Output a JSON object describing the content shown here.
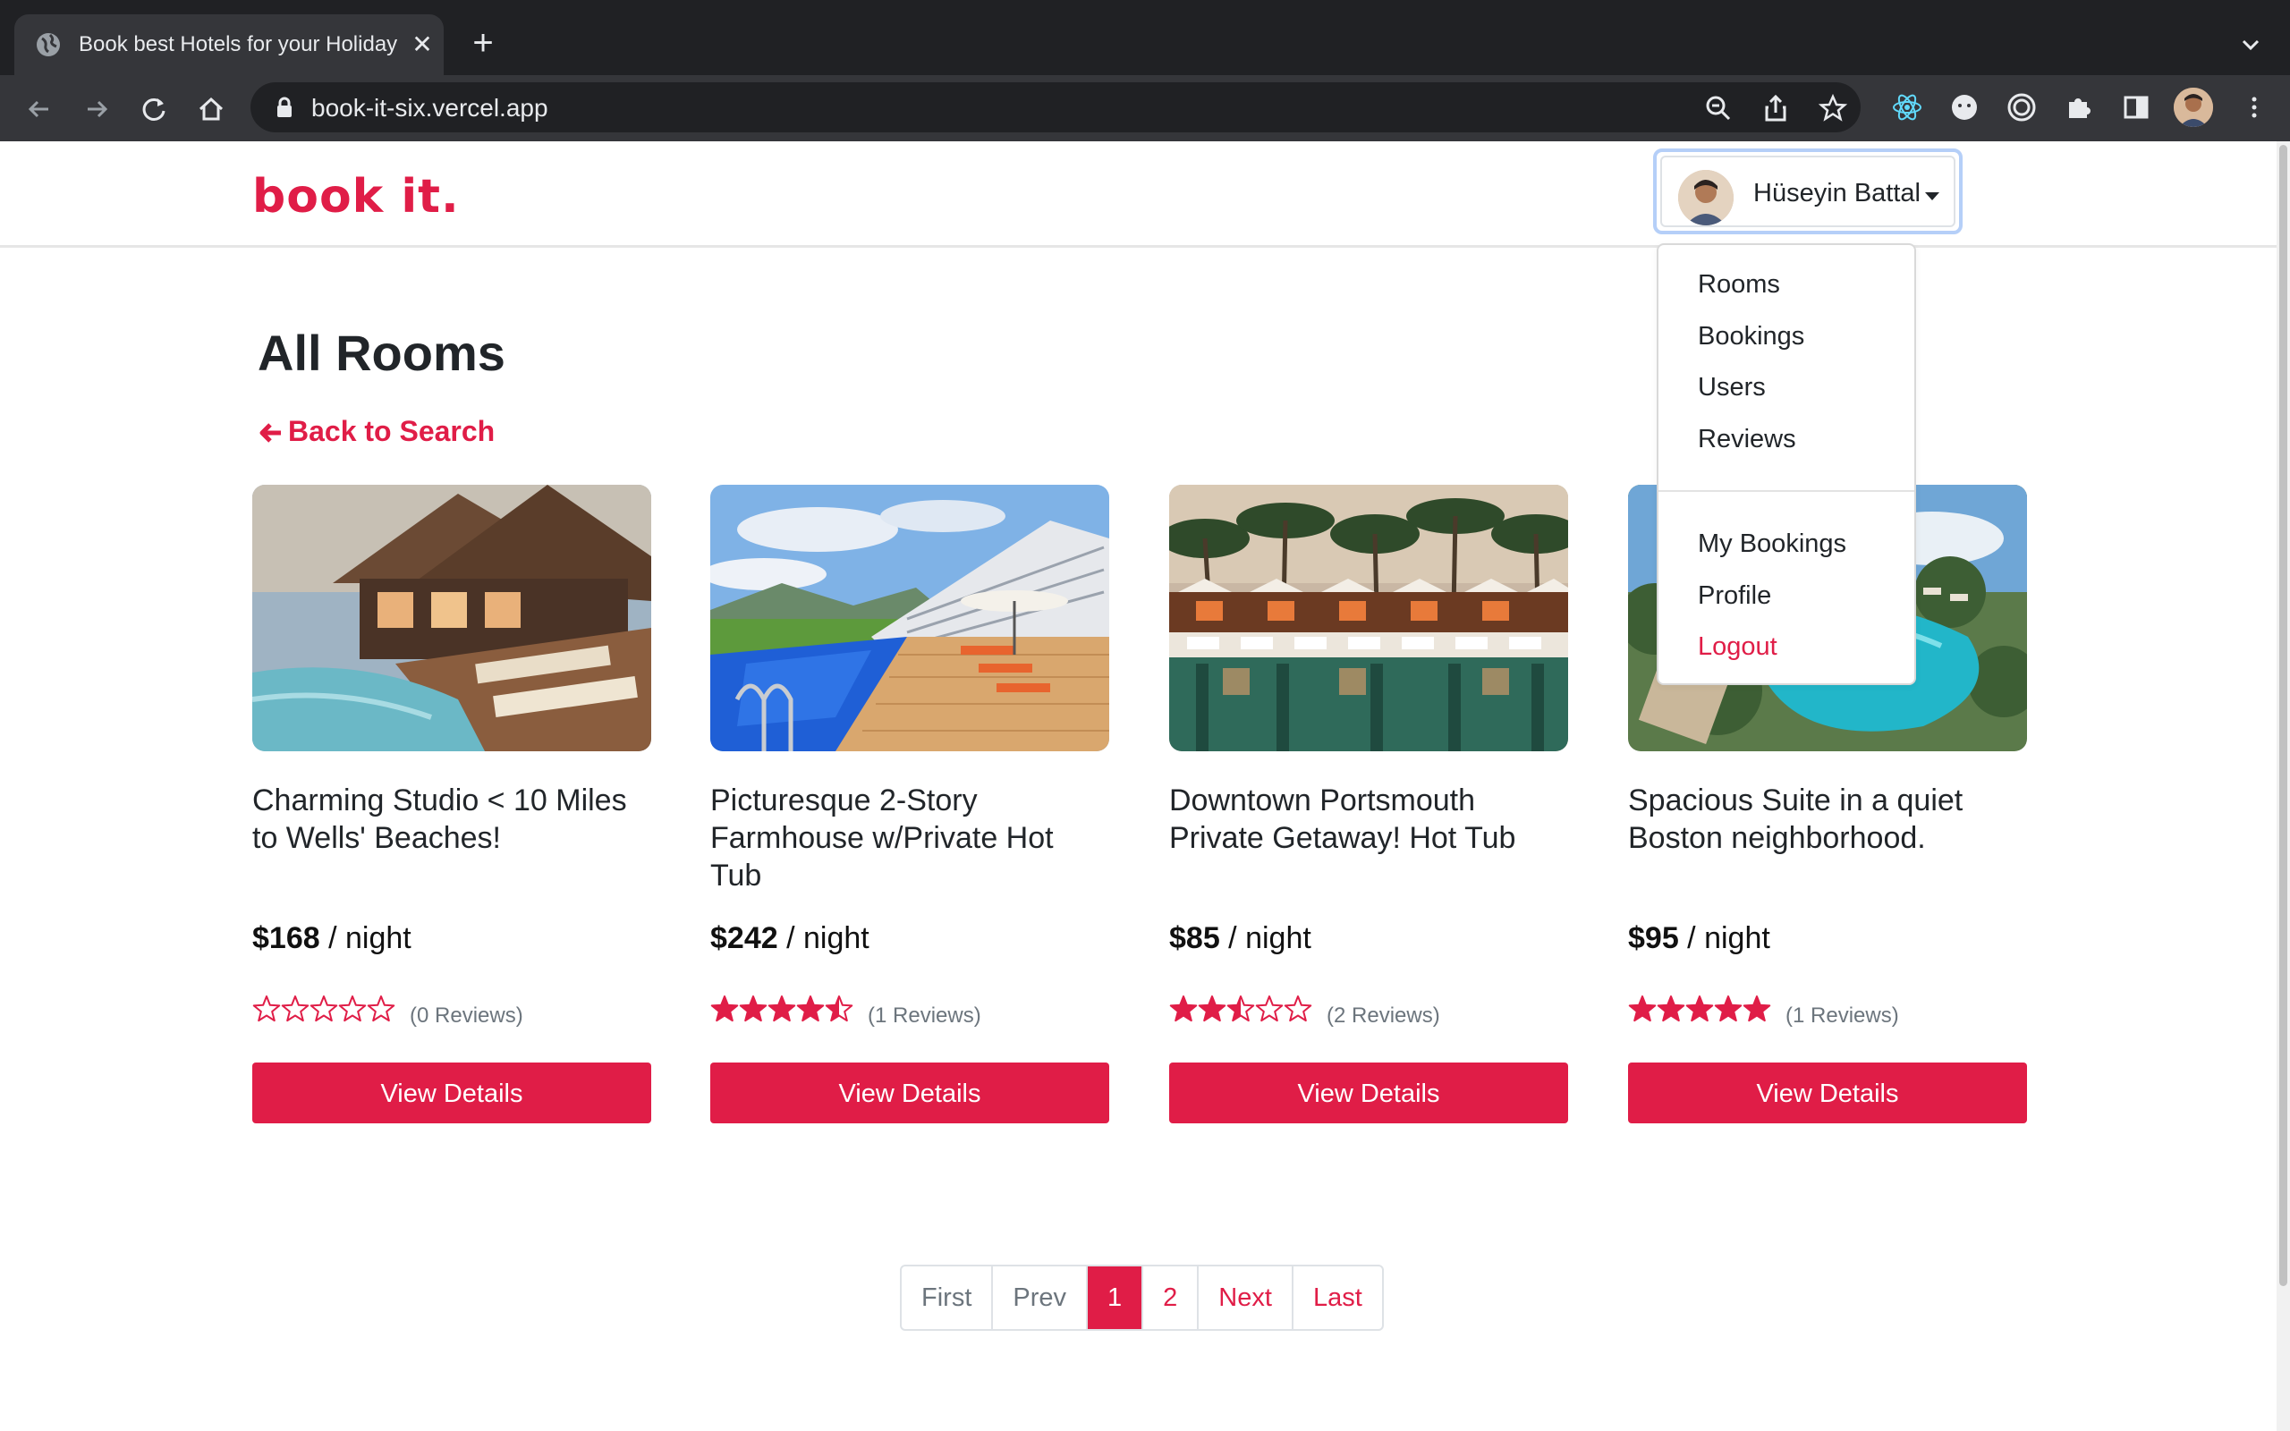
{
  "browser": {
    "tab_title": "Book best Hotels for your Holiday",
    "url": "book-it-six.vercel.app"
  },
  "navbar": {
    "logo": "book it.",
    "user_name": "Hüseyin Battal"
  },
  "dropdown": {
    "items": [
      "Rooms",
      "Bookings",
      "Users",
      "Reviews",
      "My Bookings",
      "Profile",
      "Logout"
    ]
  },
  "page": {
    "title": "All Rooms",
    "back_link": "Back to Search"
  },
  "rooms": [
    {
      "name": "Charming Studio < 10 Miles to Wells' Beaches!",
      "price": "$168",
      "per": " / night",
      "rating": 0,
      "reviews": "(0 Reviews)",
      "button": "View Details"
    },
    {
      "name": "Picturesque 2-Story Farmhouse w/Private Hot Tub",
      "price": "$242",
      "per": " / night",
      "rating": 4.5,
      "reviews": "(1 Reviews)",
      "button": "View Details"
    },
    {
      "name": "Downtown Portsmouth Private Getaway! Hot Tub",
      "price": "$85",
      "per": " / night",
      "rating": 2.5,
      "reviews": "(2 Reviews)",
      "button": "View Details"
    },
    {
      "name": "Spacious Suite in a quiet Boston neighborhood.",
      "price": "$95",
      "per": " / night",
      "rating": 5,
      "reviews": "(1 Reviews)",
      "button": "View Details"
    }
  ],
  "pagination": {
    "first": "First",
    "prev": "Prev",
    "page1": "1",
    "page2": "2",
    "next": "Next",
    "last": "Last",
    "current_page": 1
  },
  "colors": {
    "brand": "#e01d47",
    "star": "#e01d47",
    "muted": "#6c757d"
  }
}
